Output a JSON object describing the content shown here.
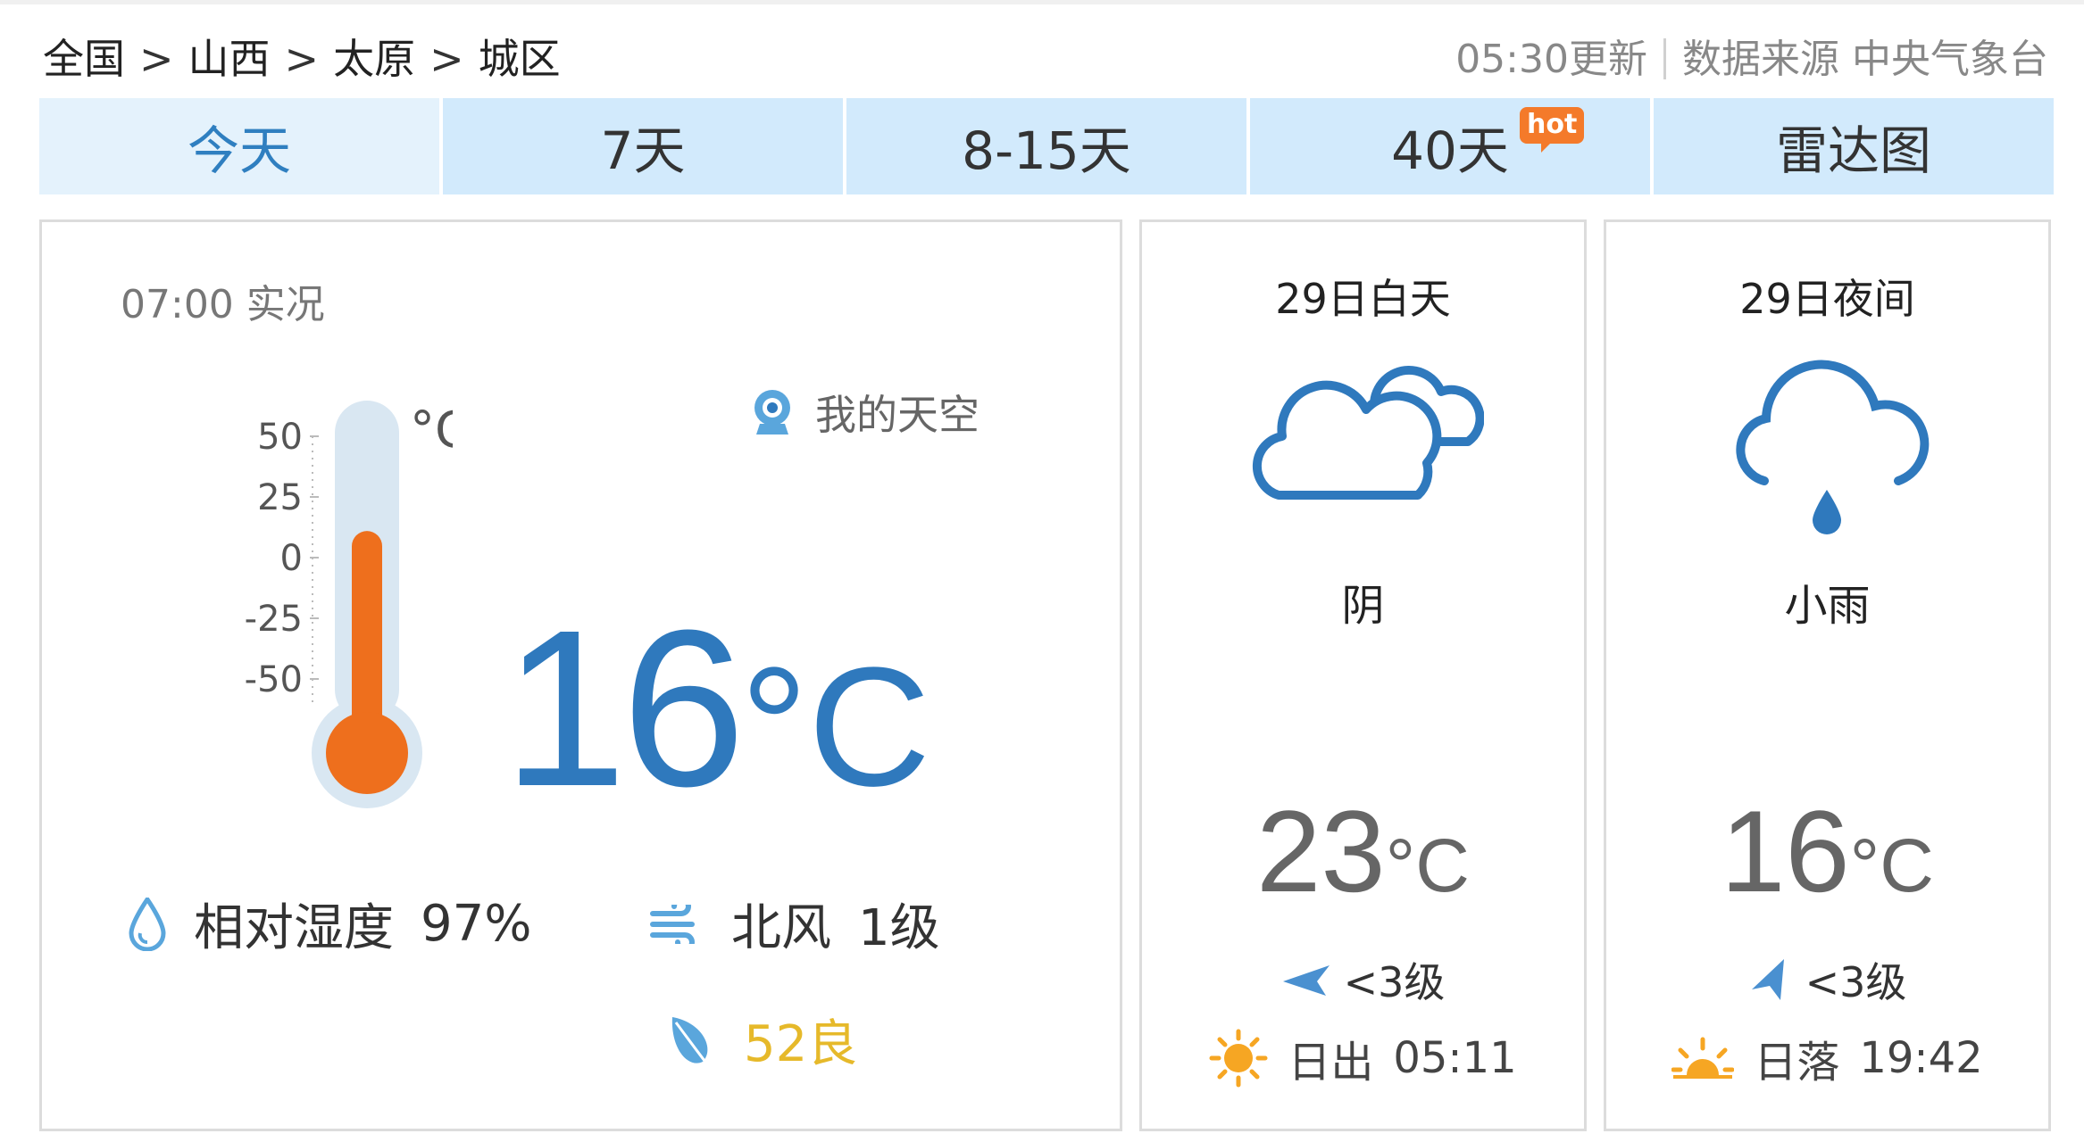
{
  "breadcrumb": {
    "items": [
      "全国",
      "山西",
      "太原",
      "城区"
    ],
    "separator": ">"
  },
  "meta": {
    "update_time": "05:30更新",
    "source": "数据来源 中央气象台"
  },
  "tabs": [
    {
      "label": "今天",
      "active": true
    },
    {
      "label": "7天",
      "active": false
    },
    {
      "label": "8-15天",
      "active": false
    },
    {
      "label": "40天",
      "active": false,
      "badge": "hot"
    },
    {
      "label": "雷达图",
      "active": false
    }
  ],
  "current": {
    "obs_label": "07:00 实况",
    "my_sky": "我的天空",
    "temperature": "16",
    "unit": "°C",
    "thermo_unit": "°C",
    "thermo_ticks": [
      "50",
      "25",
      "0",
      "-25",
      "-50"
    ],
    "thermo_fill_fraction": 0.66,
    "humidity_label": "相对湿度",
    "humidity_value": "97%",
    "wind_dir": "北风",
    "wind_level": "1级",
    "aqi": "52良"
  },
  "day": {
    "title": "29日白天",
    "weather": "阴",
    "icon": "cloudy-icon",
    "temp": "23",
    "unit": "°C",
    "wind": "<3级",
    "sun_label": "日出",
    "sun_time": "05:11"
  },
  "night": {
    "title": "29日夜间",
    "weather": "小雨",
    "icon": "light-rain-icon",
    "temp": "16",
    "unit": "°C",
    "wind": "<3级",
    "sun_label": "日落",
    "sun_time": "19:42"
  },
  "colors": {
    "tab_bg": "#d2eafc",
    "tab_active_bg": "#e4f2fc",
    "accent_blue": "#2f79bd",
    "thermo_orange": "#ee6f1d",
    "aqi_yellow": "#e6b92a",
    "hot_badge": "#f47a2a"
  }
}
